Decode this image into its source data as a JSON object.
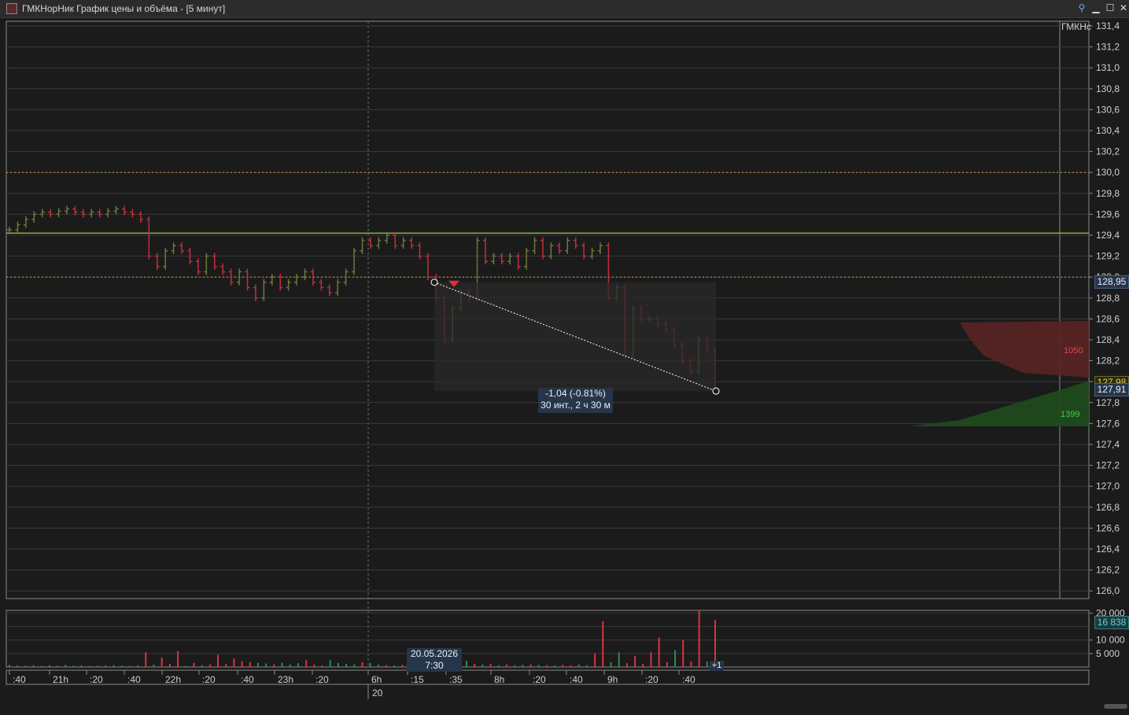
{
  "window": {
    "title": "ГМКНорНик График цены и объёма - [5 минут]",
    "icon": "chart-icon",
    "buttons": [
      "pin-icon",
      "minimize-icon",
      "maximize-icon",
      "close-icon"
    ]
  },
  "colors": {
    "background": "#1b1b1b",
    "up": "#6b7a3a",
    "down": "#c0303a",
    "volume_up": "#2e8b57",
    "volume_down": "#d9343f",
    "horizontal_level": "#9acd32",
    "dotted_level": "#d69a2d",
    "accent_label": "#26364a"
  },
  "chart_data": [
    {
      "type": "candlestick",
      "instrument_label": "ГМКНс",
      "ylim": [
        126.0,
        131.4
      ],
      "y_ticks": [
        "131,4",
        "131,2",
        "131,0",
        "130,8",
        "130,6",
        "130,4",
        "130,2",
        "130,0",
        "129,8",
        "129,6",
        "129,4",
        "129,2",
        "129,0",
        "128,8",
        "128,6",
        "128,4",
        "128,2",
        "128,0",
        "127,8",
        "127,6",
        "127,4",
        "127,2",
        "127,0",
        "126,8",
        "126,6",
        "126,4",
        "126,2",
        "126,0"
      ],
      "levels": [
        {
          "value": 130.0,
          "style": "dotted"
        },
        {
          "value": 129.0,
          "style": "dotted"
        },
        {
          "value": 129.42,
          "style": "solid"
        }
      ],
      "closes": [
        129.45,
        129.5,
        129.55,
        129.6,
        129.62,
        129.6,
        129.63,
        129.65,
        129.62,
        129.6,
        129.62,
        129.6,
        129.63,
        129.65,
        129.62,
        129.6,
        129.55,
        129.2,
        129.1,
        129.25,
        129.3,
        129.25,
        129.15,
        129.05,
        129.2,
        129.1,
        129.05,
        128.95,
        129.05,
        128.9,
        128.8,
        128.95,
        129.0,
        128.9,
        128.95,
        129.0,
        129.05,
        128.95,
        128.9,
        128.85,
        128.95,
        129.05,
        129.25,
        129.35,
        129.3,
        129.35,
        129.4,
        129.3,
        129.35,
        129.3,
        129.2,
        129.0,
        128.8,
        128.4,
        128.7,
        128.85,
        128.8,
        129.35,
        129.15,
        129.2,
        129.15,
        129.2,
        129.1,
        129.25,
        129.35,
        129.2,
        129.3,
        129.25,
        129.35,
        129.3,
        129.2,
        129.25,
        129.3,
        128.8,
        128.9,
        128.25,
        128.7,
        128.6,
        128.6,
        128.55,
        128.5,
        128.35,
        128.2,
        128.1,
        128.4,
        128.3,
        127.91
      ],
      "price_labels": [
        {
          "text": "128,95",
          "type": "crosshair"
        },
        {
          "text": "127,98",
          "type": "bid"
        },
        {
          "text": "127,91",
          "type": "last"
        }
      ],
      "measurement": {
        "line1": "-1,04 (-0.81%)",
        "line2": "30 инт., 2 ч 30 м"
      },
      "order_book": {
        "ask_volume_label": "1050",
        "bid_volume_label": "1399"
      }
    },
    {
      "type": "bar",
      "name": "volume",
      "ylim": [
        0,
        21000
      ],
      "y_ticks": [
        "20 000",
        "10 000",
        "5 000"
      ],
      "current_label": "16 838",
      "values": [
        800,
        600,
        500,
        700,
        400,
        600,
        500,
        800,
        500,
        600,
        400,
        500,
        600,
        700,
        500,
        400,
        600,
        5500,
        900,
        3500,
        1200,
        6000,
        400,
        1500,
        700,
        1000,
        4500,
        1100,
        3200,
        2200,
        1800,
        1500,
        1300,
        1000,
        1600,
        900,
        1400,
        2500,
        900,
        600,
        2500,
        1500,
        1200,
        1000,
        1800,
        1500,
        900,
        700,
        600,
        800,
        500,
        1500,
        1100,
        700,
        1300,
        2400,
        1700,
        2300,
        1200,
        900,
        1100,
        700,
        900,
        700,
        800,
        900,
        800,
        700,
        600,
        800,
        600,
        900,
        700,
        5000,
        17000,
        1800,
        5500,
        1400,
        4000,
        1200,
        5500,
        11000,
        1800,
        6200,
        10000,
        2000,
        21000,
        2000,
        17500
      ],
      "up_flags": [
        1,
        1,
        1,
        1,
        1,
        1,
        1,
        1,
        1,
        1,
        1,
        1,
        1,
        1,
        1,
        1,
        1,
        0,
        1,
        0,
        0,
        0,
        1,
        0,
        1,
        0,
        0,
        0,
        0,
        0,
        0,
        1,
        1,
        0,
        1,
        1,
        1,
        0,
        0,
        0,
        1,
        1,
        1,
        1,
        0,
        1,
        1,
        0,
        1,
        0,
        0,
        0,
        0,
        0,
        1,
        1,
        0,
        1,
        0,
        1,
        0,
        1,
        0,
        1,
        1,
        0,
        1,
        0,
        1,
        0,
        0,
        1,
        1,
        0,
        0,
        1,
        1,
        0,
        0,
        0,
        0,
        0,
        0,
        1,
        0,
        0,
        0,
        1,
        0
      ]
    }
  ],
  "time_axis": {
    "labels": [
      ":40",
      "21h",
      ":20",
      ":40",
      "22h",
      ":20",
      ":40",
      "23h",
      ":20",
      "6h",
      ":15",
      ":35",
      "8h",
      ":20",
      ":40",
      "9h",
      ":20",
      ":40"
    ],
    "date_label": "20",
    "crosshair_date": "20.05.2026",
    "crosshair_time": "7:30",
    "overflow_badge": "+1"
  }
}
